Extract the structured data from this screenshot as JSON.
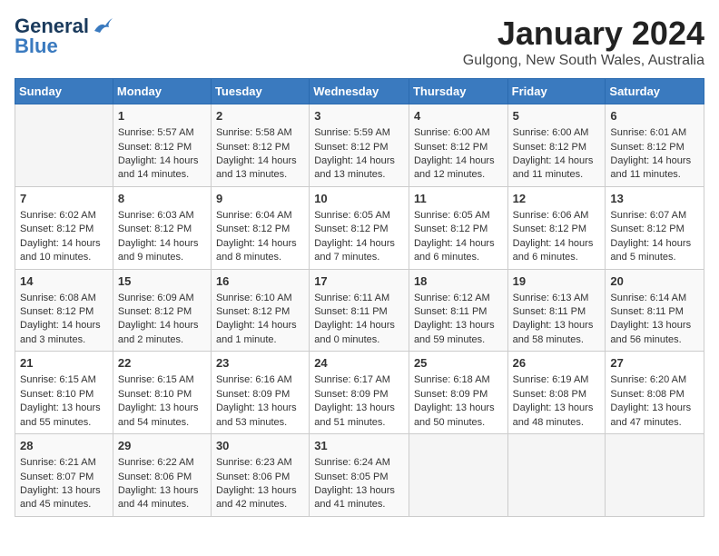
{
  "header": {
    "logo_general": "General",
    "logo_blue": "Blue",
    "title": "January 2024",
    "subtitle": "Gulgong, New South Wales, Australia"
  },
  "days_of_week": [
    "Sunday",
    "Monday",
    "Tuesday",
    "Wednesday",
    "Thursday",
    "Friday",
    "Saturday"
  ],
  "weeks": [
    [
      {
        "day": "",
        "content": ""
      },
      {
        "day": "1",
        "content": "Sunrise: 5:57 AM\nSunset: 8:12 PM\nDaylight: 14 hours\nand 14 minutes."
      },
      {
        "day": "2",
        "content": "Sunrise: 5:58 AM\nSunset: 8:12 PM\nDaylight: 14 hours\nand 13 minutes."
      },
      {
        "day": "3",
        "content": "Sunrise: 5:59 AM\nSunset: 8:12 PM\nDaylight: 14 hours\nand 13 minutes."
      },
      {
        "day": "4",
        "content": "Sunrise: 6:00 AM\nSunset: 8:12 PM\nDaylight: 14 hours\nand 12 minutes."
      },
      {
        "day": "5",
        "content": "Sunrise: 6:00 AM\nSunset: 8:12 PM\nDaylight: 14 hours\nand 11 minutes."
      },
      {
        "day": "6",
        "content": "Sunrise: 6:01 AM\nSunset: 8:12 PM\nDaylight: 14 hours\nand 11 minutes."
      }
    ],
    [
      {
        "day": "7",
        "content": "Sunrise: 6:02 AM\nSunset: 8:12 PM\nDaylight: 14 hours\nand 10 minutes."
      },
      {
        "day": "8",
        "content": "Sunrise: 6:03 AM\nSunset: 8:12 PM\nDaylight: 14 hours\nand 9 minutes."
      },
      {
        "day": "9",
        "content": "Sunrise: 6:04 AM\nSunset: 8:12 PM\nDaylight: 14 hours\nand 8 minutes."
      },
      {
        "day": "10",
        "content": "Sunrise: 6:05 AM\nSunset: 8:12 PM\nDaylight: 14 hours\nand 7 minutes."
      },
      {
        "day": "11",
        "content": "Sunrise: 6:05 AM\nSunset: 8:12 PM\nDaylight: 14 hours\nand 6 minutes."
      },
      {
        "day": "12",
        "content": "Sunrise: 6:06 AM\nSunset: 8:12 PM\nDaylight: 14 hours\nand 6 minutes."
      },
      {
        "day": "13",
        "content": "Sunrise: 6:07 AM\nSunset: 8:12 PM\nDaylight: 14 hours\nand 5 minutes."
      }
    ],
    [
      {
        "day": "14",
        "content": "Sunrise: 6:08 AM\nSunset: 8:12 PM\nDaylight: 14 hours\nand 3 minutes."
      },
      {
        "day": "15",
        "content": "Sunrise: 6:09 AM\nSunset: 8:12 PM\nDaylight: 14 hours\nand 2 minutes."
      },
      {
        "day": "16",
        "content": "Sunrise: 6:10 AM\nSunset: 8:12 PM\nDaylight: 14 hours\nand 1 minute."
      },
      {
        "day": "17",
        "content": "Sunrise: 6:11 AM\nSunset: 8:11 PM\nDaylight: 14 hours\nand 0 minutes."
      },
      {
        "day": "18",
        "content": "Sunrise: 6:12 AM\nSunset: 8:11 PM\nDaylight: 13 hours\nand 59 minutes."
      },
      {
        "day": "19",
        "content": "Sunrise: 6:13 AM\nSunset: 8:11 PM\nDaylight: 13 hours\nand 58 minutes."
      },
      {
        "day": "20",
        "content": "Sunrise: 6:14 AM\nSunset: 8:11 PM\nDaylight: 13 hours\nand 56 minutes."
      }
    ],
    [
      {
        "day": "21",
        "content": "Sunrise: 6:15 AM\nSunset: 8:10 PM\nDaylight: 13 hours\nand 55 minutes."
      },
      {
        "day": "22",
        "content": "Sunrise: 6:15 AM\nSunset: 8:10 PM\nDaylight: 13 hours\nand 54 minutes."
      },
      {
        "day": "23",
        "content": "Sunrise: 6:16 AM\nSunset: 8:09 PM\nDaylight: 13 hours\nand 53 minutes."
      },
      {
        "day": "24",
        "content": "Sunrise: 6:17 AM\nSunset: 8:09 PM\nDaylight: 13 hours\nand 51 minutes."
      },
      {
        "day": "25",
        "content": "Sunrise: 6:18 AM\nSunset: 8:09 PM\nDaylight: 13 hours\nand 50 minutes."
      },
      {
        "day": "26",
        "content": "Sunrise: 6:19 AM\nSunset: 8:08 PM\nDaylight: 13 hours\nand 48 minutes."
      },
      {
        "day": "27",
        "content": "Sunrise: 6:20 AM\nSunset: 8:08 PM\nDaylight: 13 hours\nand 47 minutes."
      }
    ],
    [
      {
        "day": "28",
        "content": "Sunrise: 6:21 AM\nSunset: 8:07 PM\nDaylight: 13 hours\nand 45 minutes."
      },
      {
        "day": "29",
        "content": "Sunrise: 6:22 AM\nSunset: 8:06 PM\nDaylight: 13 hours\nand 44 minutes."
      },
      {
        "day": "30",
        "content": "Sunrise: 6:23 AM\nSunset: 8:06 PM\nDaylight: 13 hours\nand 42 minutes."
      },
      {
        "day": "31",
        "content": "Sunrise: 6:24 AM\nSunset: 8:05 PM\nDaylight: 13 hours\nand 41 minutes."
      },
      {
        "day": "",
        "content": ""
      },
      {
        "day": "",
        "content": ""
      },
      {
        "day": "",
        "content": ""
      }
    ]
  ]
}
